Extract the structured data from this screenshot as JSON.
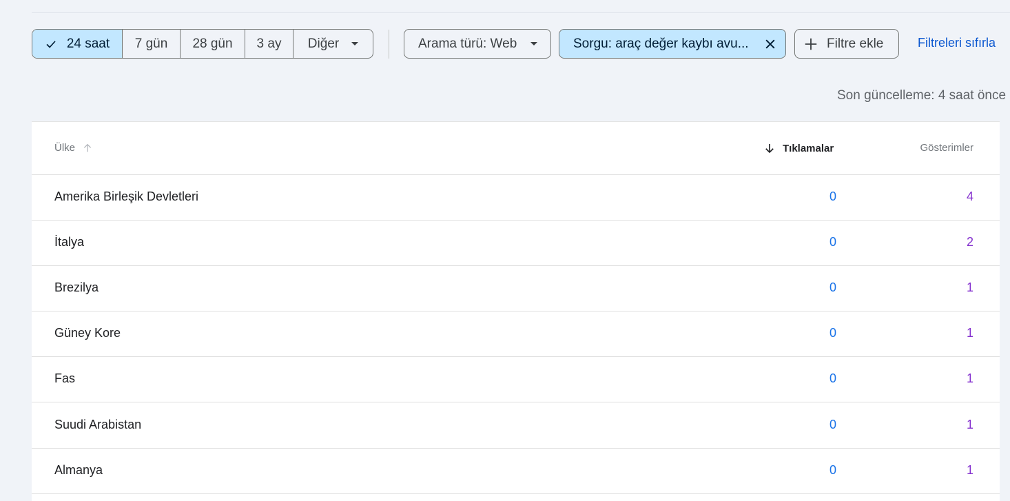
{
  "toolbar": {
    "date_ranges": [
      "24 saat",
      "7 gün",
      "28 gün",
      "3 ay"
    ],
    "selected_range": "24 saat",
    "more_label": "Diğer",
    "search_type_chip": "Arama türü: Web",
    "query_chip": "Sorgu: araç değer kaybı avu...",
    "add_filter_label": "Filtre ekle",
    "reset_label": "Filtreleri sıfırla"
  },
  "status": {
    "last_updated": "Son güncelleme: 4 saat önce"
  },
  "table": {
    "headers": {
      "country": "Ülke",
      "clicks": "Tıklamalar",
      "impressions": "Gösterimler"
    },
    "rows": [
      {
        "country": "Amerika Birleşik Devletleri",
        "clicks": "0",
        "impressions": "4"
      },
      {
        "country": "İtalya",
        "clicks": "0",
        "impressions": "2"
      },
      {
        "country": "Brezilya",
        "clicks": "0",
        "impressions": "1"
      },
      {
        "country": "Güney Kore",
        "clicks": "0",
        "impressions": "1"
      },
      {
        "country": "Fas",
        "clicks": "0",
        "impressions": "1"
      },
      {
        "country": "Suudi Arabistan",
        "clicks": "0",
        "impressions": "1"
      },
      {
        "country": "Almanya",
        "clicks": "0",
        "impressions": "1"
      }
    ]
  },
  "colors": {
    "selected_chip_bg": "#c2e7ff",
    "clicks_metric": "#1a73e8",
    "impressions_metric": "#8430ce",
    "link": "#0b57d0"
  }
}
